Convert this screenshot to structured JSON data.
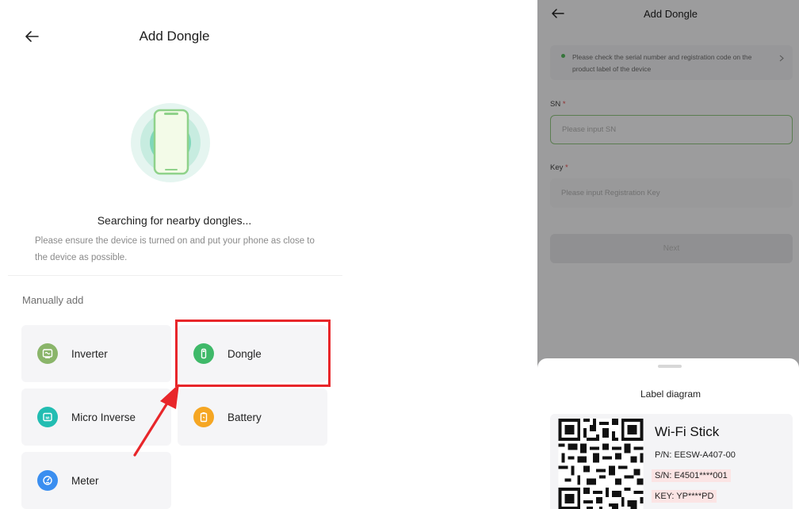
{
  "left": {
    "title": "Add Dongle",
    "search_title": "Searching for nearby dongles...",
    "search_desc": "Please ensure the device is turned on and put your phone as close to the device as possible.",
    "manual_title": "Manually add",
    "devices": [
      {
        "label": "Inverter",
        "icon": "inverter-icon",
        "color": "#8ab56a"
      },
      {
        "label": "Dongle",
        "icon": "dongle-icon",
        "color": "#3fb969"
      },
      {
        "label": "Micro Inverse",
        "icon": "micro-inverse-icon",
        "color": "#22bdb2"
      },
      {
        "label": "Battery",
        "icon": "battery-icon",
        "color": "#f5a623"
      },
      {
        "label": "Meter",
        "icon": "meter-icon",
        "color": "#3a8ef0"
      }
    ],
    "highlight_color": "#e8262a"
  },
  "right": {
    "title": "Add Dongle",
    "notice": "Please check the serial number and registration code on the product label of the device",
    "sn_label": "SN",
    "sn_placeholder": "Please input SN",
    "key_label": "Key",
    "key_placeholder": "Please input Registration Key",
    "required_mark": "*",
    "next_label": "Next",
    "sheet": {
      "title": "Label diagram",
      "product": "Wi-Fi Stick",
      "pn": "P/N: EESW-A407-00",
      "sn": "S/N: E4501****001",
      "key": "KEY: YP****PD"
    }
  }
}
